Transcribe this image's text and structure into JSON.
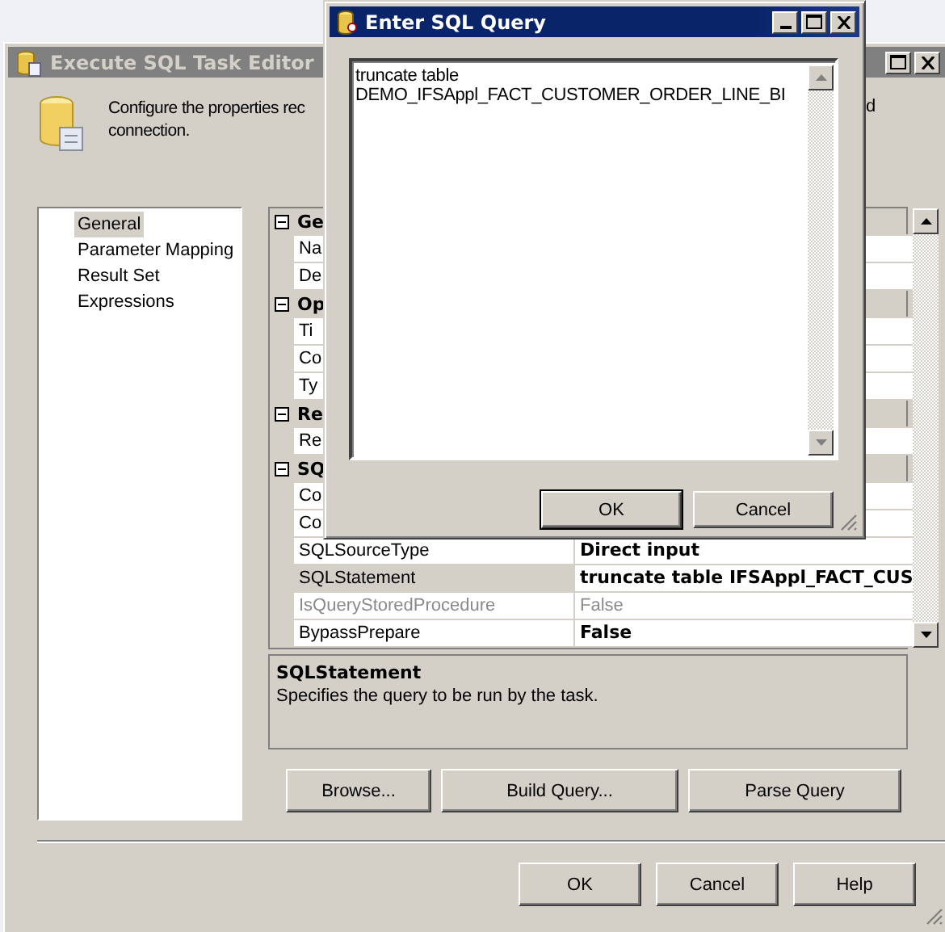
{
  "main_window": {
    "title": "Execute SQL Task Editor",
    "description_lines": [
      "Configure the properties rec",
      "connection."
    ],
    "description_fragment": "d"
  },
  "sidebar": {
    "items": [
      {
        "label": "General",
        "selected": true
      },
      {
        "label": "Parameter Mapping",
        "selected": false
      },
      {
        "label": "Result Set",
        "selected": false
      },
      {
        "label": "Expressions",
        "selected": false
      }
    ]
  },
  "property_grid": {
    "categories": [
      {
        "name": "Ge",
        "expanded": true,
        "properties": [
          {
            "name": "Na",
            "selected": false,
            "disabled": false,
            "modified": false
          },
          {
            "name": "De",
            "selected": false,
            "disabled": false,
            "modified": false
          }
        ]
      },
      {
        "name": "Op",
        "expanded": true,
        "properties": [
          {
            "name": "Ti",
            "selected": false,
            "disabled": false,
            "modified": false
          },
          {
            "name": "Co",
            "selected": false,
            "disabled": false,
            "modified": false
          },
          {
            "name": "Ty",
            "selected": false,
            "disabled": false,
            "modified": false
          }
        ]
      },
      {
        "name": "Re",
        "expanded": true,
        "properties": [
          {
            "name": "Re",
            "selected": false,
            "disabled": false,
            "modified": false
          }
        ]
      },
      {
        "name": "SQ",
        "expanded": true,
        "properties": [
          {
            "name": "Co",
            "selected": false,
            "disabled": false,
            "modified": false
          },
          {
            "name": "Co",
            "selected": false,
            "disabled": false,
            "modified": false
          },
          {
            "name": "SQLSourceType",
            "value": "Direct input",
            "selected": false,
            "disabled": false,
            "modified": true
          },
          {
            "name": "SQLStatement",
            "value": "truncate table IFSAppl_FACT_CUS",
            "selected": true,
            "disabled": false,
            "modified": true
          },
          {
            "name": "IsQueryStoredProcedure",
            "value": "False",
            "selected": false,
            "disabled": true,
            "modified": false
          },
          {
            "name": "BypassPrepare",
            "value": "False",
            "selected": false,
            "disabled": false,
            "modified": true
          }
        ]
      }
    ]
  },
  "help_panel": {
    "title": "SQLStatement",
    "text": "Specifies the query to be run by the task."
  },
  "query_buttons": [
    "Browse...",
    "Build Query...",
    "Parse Query"
  ],
  "dialog_buttons": [
    "OK",
    "Cancel",
    "Help"
  ],
  "query_dialog": {
    "title": "Enter SQL Query",
    "lines": [
      "truncate table",
      "DEMO_IFSAppl_FACT_CUSTOMER_ORDER_LINE_BI"
    ],
    "buttons": [
      {
        "label": "OK",
        "default": true
      },
      {
        "label": "Cancel",
        "default": false
      }
    ]
  }
}
